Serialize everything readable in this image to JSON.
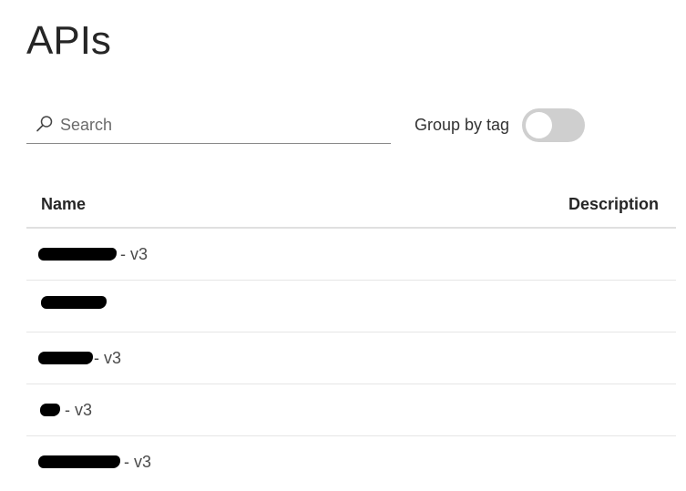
{
  "page": {
    "title": "APIs"
  },
  "search": {
    "placeholder": "Search",
    "value": ""
  },
  "group_by_tag": {
    "label": "Group by tag",
    "enabled": false
  },
  "table": {
    "columns": [
      "Name",
      "Description"
    ],
    "rows": [
      {
        "name": "[redacted]",
        "version": "- v3",
        "description": ""
      },
      {
        "name": "[redacted]",
        "version": "",
        "description": ""
      },
      {
        "name": "[redacted]",
        "version": "- v3",
        "description": ""
      },
      {
        "name": "[redacted]",
        "version": "- v3",
        "description": ""
      },
      {
        "name": "[redacted]",
        "version": "- v3",
        "description": ""
      }
    ]
  },
  "colors": {
    "toggle_off": "#cfcfcf",
    "text": "#333333",
    "divider": "#e0e0e0"
  },
  "icons": {
    "search": "search-icon"
  }
}
